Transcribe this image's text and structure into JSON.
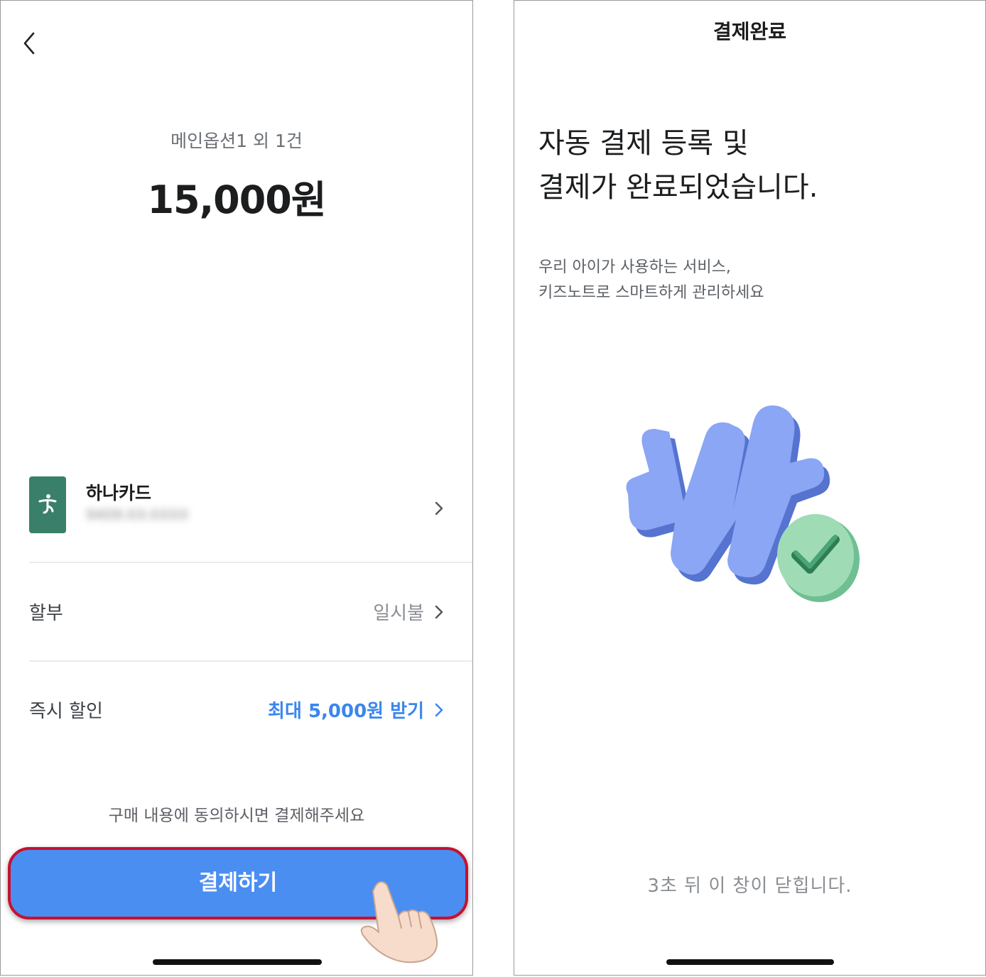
{
  "left_screen": {
    "order": {
      "title": "메인옵션1 외 1건",
      "amount": "15,000원"
    },
    "payment_method": {
      "card_name": "하나카드",
      "card_number": "9409-XX-XXXX"
    },
    "installment": {
      "label": "할부",
      "value": "일시불"
    },
    "discount": {
      "label": "즉시 할인",
      "value": "최대 5,000원 받기"
    },
    "agree_text": "구매 내용에 동의하시면 결제해주세요",
    "pay_button_label": "결제하기",
    "colors": {
      "primary_button": "#4a8ef2",
      "highlight_border": "#c8102e",
      "card_logo": "#3a7f6a",
      "discount_text": "#3a86f0"
    }
  },
  "right_screen": {
    "header_title": "결제완료",
    "headline": {
      "line1": "자동 결제 등록 및",
      "line2": "결제가 완료되었습니다."
    },
    "subtext": {
      "line1": "우리 아이가 사용하는 서비스,",
      "line2": "키즈노트로 스마트하게 관리하세요"
    },
    "close_notice": "3초 뒤 이 창이 닫힙니다.",
    "colors": {
      "logo_face": "#8aa6f4",
      "logo_side": "#5573cf",
      "check_badge": "#9fdcb6"
    }
  },
  "icons": [
    "back-chevron-icon",
    "hana-card-logo-icon",
    "chevron-right-icon",
    "tap-hand-icon",
    "w-logo-icon",
    "check-circle-icon"
  ]
}
